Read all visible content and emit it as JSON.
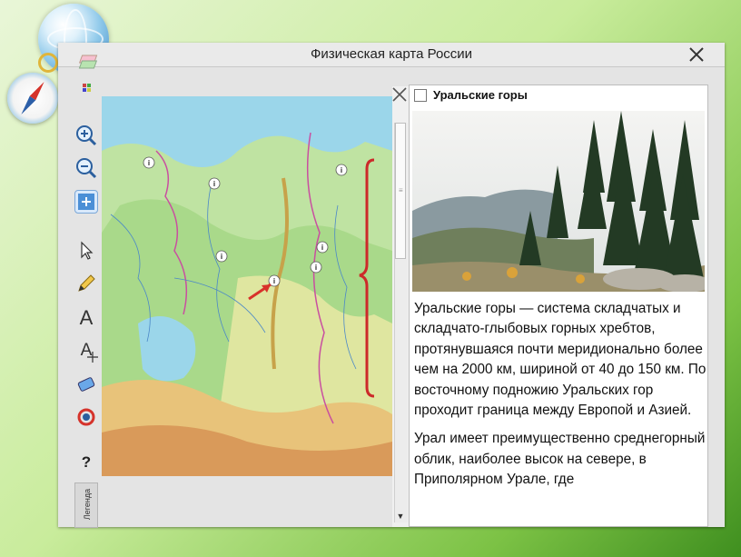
{
  "window": {
    "title": "Физическая карта России",
    "close_label": "✕"
  },
  "toolbar": {
    "tools": [
      {
        "name": "zoom-in",
        "glyph": "⊕"
      },
      {
        "name": "zoom-out",
        "glyph": "⊖"
      },
      {
        "name": "fit-map",
        "glyph": "⊡"
      },
      {
        "name": "pointer",
        "glyph": "↖"
      },
      {
        "name": "pencil",
        "glyph": "✎"
      },
      {
        "name": "text",
        "glyph": "A"
      },
      {
        "name": "text-move",
        "glyph": "A"
      },
      {
        "name": "eraser",
        "glyph": "▰"
      },
      {
        "name": "undo",
        "glyph": "↺"
      },
      {
        "name": "help",
        "glyph": "?"
      }
    ],
    "legend_label": "Легенда"
  },
  "map": {
    "info_marker": "i"
  },
  "panel": {
    "close_glyph": "✕",
    "title": "Уральские горы",
    "paragraphs": [
      "Уральские горы — система складчатых и складчато-глыбовых горных хребтов, протянувшаяся почти меридионально более чем на 2000 км, шириной от 40 до 150 км. По восточному подножию Уральских гор проходит граница между Европой и Азией.",
      "Урал имеет преимущественно среднегорный облик, наиболее высок на севере, в Приполярном Урале, где"
    ],
    "scroll_down": "▼"
  },
  "colors": {
    "accent": "#2b5f9e",
    "bracket": "#cc2a2a",
    "arrow": "#d8322a"
  }
}
